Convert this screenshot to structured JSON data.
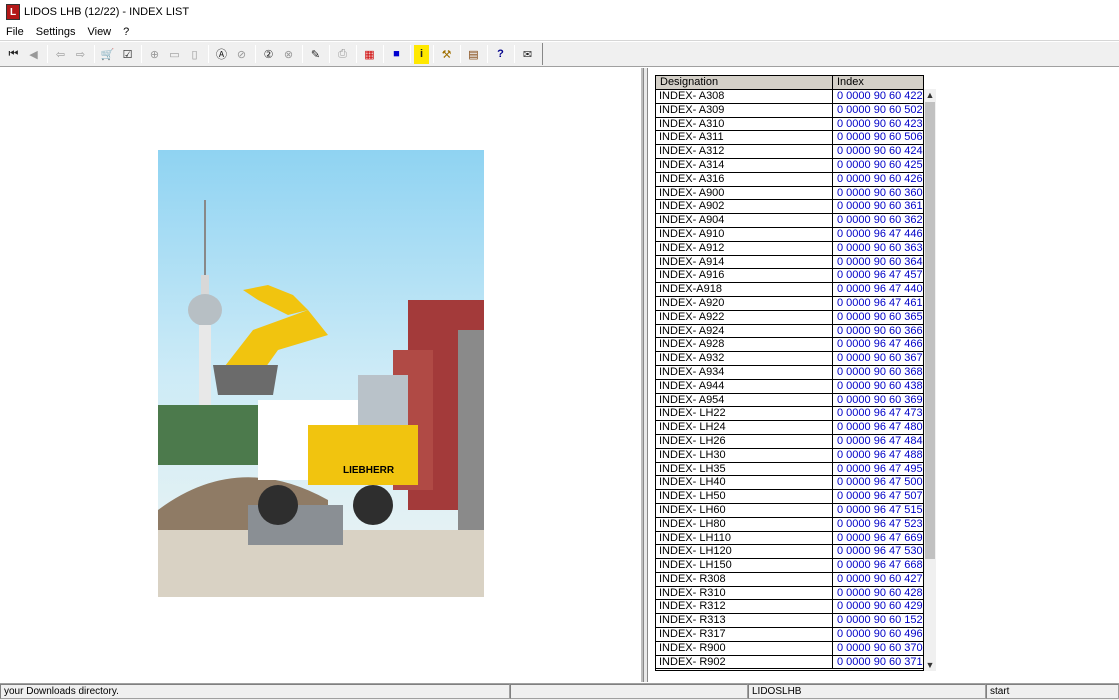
{
  "window": {
    "title": "LIDOS LHB (12/22) - INDEX LIST",
    "app_icon_glyph": "L"
  },
  "menu": {
    "items": [
      "File",
      "Settings",
      "View",
      "?"
    ]
  },
  "toolbar": {
    "buttons": [
      {
        "icon": "first-page-icon",
        "glyph": "⏮"
      },
      {
        "icon": "previous-icon",
        "glyph": "◀"
      },
      {
        "icon": "back-doc-icon",
        "glyph": "⇦"
      },
      {
        "icon": "forward-doc-icon",
        "glyph": "⇨"
      },
      {
        "icon": "cart-icon",
        "glyph": "🛒"
      },
      {
        "icon": "checklist-icon",
        "glyph": "☑"
      },
      {
        "icon": "zoom-in-icon",
        "glyph": "⊕"
      },
      {
        "icon": "fit-page-icon",
        "glyph": "▭"
      },
      {
        "icon": "fit-width-icon",
        "glyph": "▯"
      },
      {
        "icon": "search-a-icon",
        "glyph": "Ⓐ"
      },
      {
        "icon": "search-next-icon",
        "glyph": "⊘"
      },
      {
        "icon": "search-2-icon",
        "glyph": "②"
      },
      {
        "icon": "search-clear-icon",
        "glyph": "⊗"
      },
      {
        "icon": "edit-icon",
        "glyph": "✎"
      },
      {
        "icon": "print-icon",
        "glyph": "⎙"
      },
      {
        "icon": "grid-icon",
        "glyph": "▦"
      },
      {
        "icon": "blue-box-icon",
        "glyph": "■"
      },
      {
        "icon": "info-icon",
        "glyph": "i"
      },
      {
        "icon": "tools-icon",
        "glyph": "⚒"
      },
      {
        "icon": "books-icon",
        "glyph": "▤"
      },
      {
        "icon": "help-lidos-icon",
        "glyph": "?"
      },
      {
        "icon": "mail-icon",
        "glyph": "✉"
      }
    ]
  },
  "colors": {
    "index_text": "#0000c8",
    "header_bg": "#d4d0c8",
    "toolbar_bg": "#f0f0f0"
  },
  "grid": {
    "headers": {
      "designation": "Designation",
      "index": "Index"
    },
    "rows": [
      {
        "designation": "INDEX- A308",
        "index": "0 0000 90 60 422"
      },
      {
        "designation": "INDEX- A309",
        "index": "0 0000 90 60 502"
      },
      {
        "designation": "INDEX- A310",
        "index": "0 0000 90 60 423"
      },
      {
        "designation": "INDEX- A311",
        "index": "0 0000 90 60 506"
      },
      {
        "designation": "INDEX- A312",
        "index": "0 0000 90 60 424"
      },
      {
        "designation": "INDEX- A314",
        "index": "0 0000 90 60 425"
      },
      {
        "designation": "INDEX- A316",
        "index": "0 0000 90 60 426"
      },
      {
        "designation": "INDEX- A900",
        "index": "0 0000 90 60 360"
      },
      {
        "designation": "INDEX- A902",
        "index": "0 0000 90 60 361"
      },
      {
        "designation": "INDEX- A904",
        "index": "0 0000 90 60 362"
      },
      {
        "designation": "INDEX- A910",
        "index": "0 0000 96 47 446"
      },
      {
        "designation": "INDEX- A912",
        "index": "0 0000 90 60 363"
      },
      {
        "designation": "INDEX- A914",
        "index": "0 0000 90 60 364"
      },
      {
        "designation": "INDEX- A916",
        "index": "0 0000 96 47 457"
      },
      {
        "designation": "INDEX-A918",
        "index": "0 0000 96 47 440"
      },
      {
        "designation": "INDEX- A920",
        "index": "0 0000 96 47 461"
      },
      {
        "designation": "INDEX- A922",
        "index": "0 0000 90 60 365"
      },
      {
        "designation": "INDEX- A924",
        "index": "0 0000 90 60 366"
      },
      {
        "designation": "INDEX- A928",
        "index": "0 0000 96 47 466"
      },
      {
        "designation": "INDEX- A932",
        "index": "0 0000 90 60 367"
      },
      {
        "designation": "INDEX- A934",
        "index": "0 0000 90 60 368"
      },
      {
        "designation": "INDEX- A944",
        "index": "0 0000 90 60 438"
      },
      {
        "designation": "INDEX- A954",
        "index": "0 0000 90 60 369"
      },
      {
        "designation": "INDEX- LH22",
        "index": "0 0000 96 47 473"
      },
      {
        "designation": "INDEX- LH24",
        "index": "0 0000 96 47 480"
      },
      {
        "designation": "INDEX- LH26",
        "index": "0 0000 96 47 484"
      },
      {
        "designation": "INDEX- LH30",
        "index": "0 0000 96 47 488"
      },
      {
        "designation": "INDEX- LH35",
        "index": "0 0000 96 47 495"
      },
      {
        "designation": "INDEX- LH40",
        "index": "0 0000 96 47 500"
      },
      {
        "designation": "INDEX- LH50",
        "index": "0 0000 96 47 507"
      },
      {
        "designation": "INDEX- LH60",
        "index": "0 0000 96 47 515"
      },
      {
        "designation": "INDEX- LH80",
        "index": "0 0000 96 47 523"
      },
      {
        "designation": "INDEX- LH110",
        "index": "0 0000 96 47 669"
      },
      {
        "designation": "INDEX- LH120",
        "index": "0 0000 96 47 530"
      },
      {
        "designation": "INDEX- LH150",
        "index": "0 0000 96 47 668"
      },
      {
        "designation": "INDEX- R308",
        "index": "0 0000 90 60 427"
      },
      {
        "designation": "INDEX- R310",
        "index": "0 0000 90 60 428"
      },
      {
        "designation": "INDEX- R312",
        "index": "0 0000 90 60 429"
      },
      {
        "designation": "INDEX- R313",
        "index": "0 0000 90 60 152"
      },
      {
        "designation": "INDEX- R317",
        "index": "0 0000 90 60 496"
      },
      {
        "designation": "INDEX- R900",
        "index": "0 0000 90 60 370"
      },
      {
        "designation": "INDEX- R902",
        "index": "0 0000 90 60 371"
      }
    ]
  },
  "photo": {
    "brand_text": "LIEBHERR"
  },
  "status": {
    "left": "your Downloads directory.",
    "middle": "LIDOSLHB",
    "right": "start"
  }
}
